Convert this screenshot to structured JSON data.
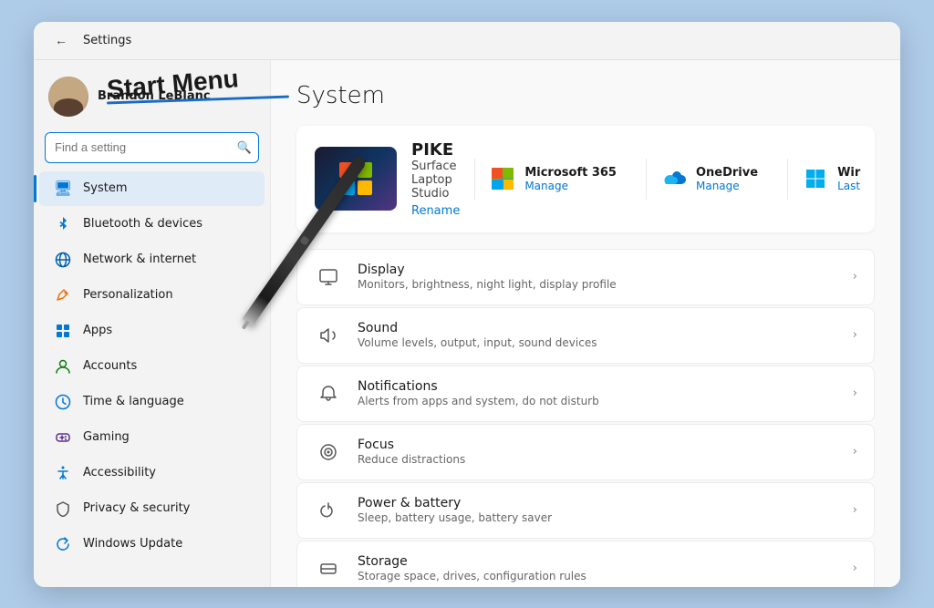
{
  "window": {
    "title": "Settings"
  },
  "user": {
    "name": "Brandon LeBlanc"
  },
  "search": {
    "placeholder": "Find a setting",
    "value": ""
  },
  "annotation": {
    "text": "Start Menu"
  },
  "sidebar": {
    "items": [
      {
        "id": "system",
        "label": "System",
        "icon": "🖥",
        "active": true
      },
      {
        "id": "bluetooth",
        "label": "Bluetooth & devices",
        "icon": "⬡",
        "active": false
      },
      {
        "id": "network",
        "label": "Network & internet",
        "icon": "🌐",
        "active": false
      },
      {
        "id": "personalization",
        "label": "Personalization",
        "icon": "✏",
        "active": false
      },
      {
        "id": "apps",
        "label": "Apps",
        "icon": "📦",
        "active": false
      },
      {
        "id": "accounts",
        "label": "Accounts",
        "icon": "👤",
        "active": false
      },
      {
        "id": "time",
        "label": "Time & language",
        "icon": "🕐",
        "active": false
      },
      {
        "id": "gaming",
        "label": "Gaming",
        "icon": "🎮",
        "active": false
      },
      {
        "id": "accessibility",
        "label": "Accessibility",
        "icon": "♿",
        "active": false
      },
      {
        "id": "privacy",
        "label": "Privacy & security",
        "icon": "🛡",
        "active": false
      },
      {
        "id": "update",
        "label": "Windows Update",
        "icon": "🔄",
        "active": false
      }
    ]
  },
  "main": {
    "title": "System",
    "device": {
      "name": "PIKE",
      "model": "Surface Laptop Studio",
      "rename": "Rename"
    },
    "services": [
      {
        "id": "m365",
        "name": "Microsoft 365",
        "action": "Manage"
      },
      {
        "id": "onedrive",
        "name": "OneDrive",
        "action": "Manage"
      },
      {
        "id": "windows",
        "name": "Wir",
        "action": "Last"
      }
    ],
    "settings": [
      {
        "id": "display",
        "name": "Display",
        "desc": "Monitors, brightness, night light, display profile"
      },
      {
        "id": "sound",
        "name": "Sound",
        "desc": "Volume levels, output, input, sound devices"
      },
      {
        "id": "notifications",
        "name": "Notifications",
        "desc": "Alerts from apps and system, do not disturb"
      },
      {
        "id": "focus",
        "name": "Focus",
        "desc": "Reduce distractions"
      },
      {
        "id": "power",
        "name": "Power & battery",
        "desc": "Sleep, battery usage, battery saver"
      },
      {
        "id": "storage",
        "name": "Storage",
        "desc": "Storage space, drives, configuration rules"
      }
    ]
  }
}
